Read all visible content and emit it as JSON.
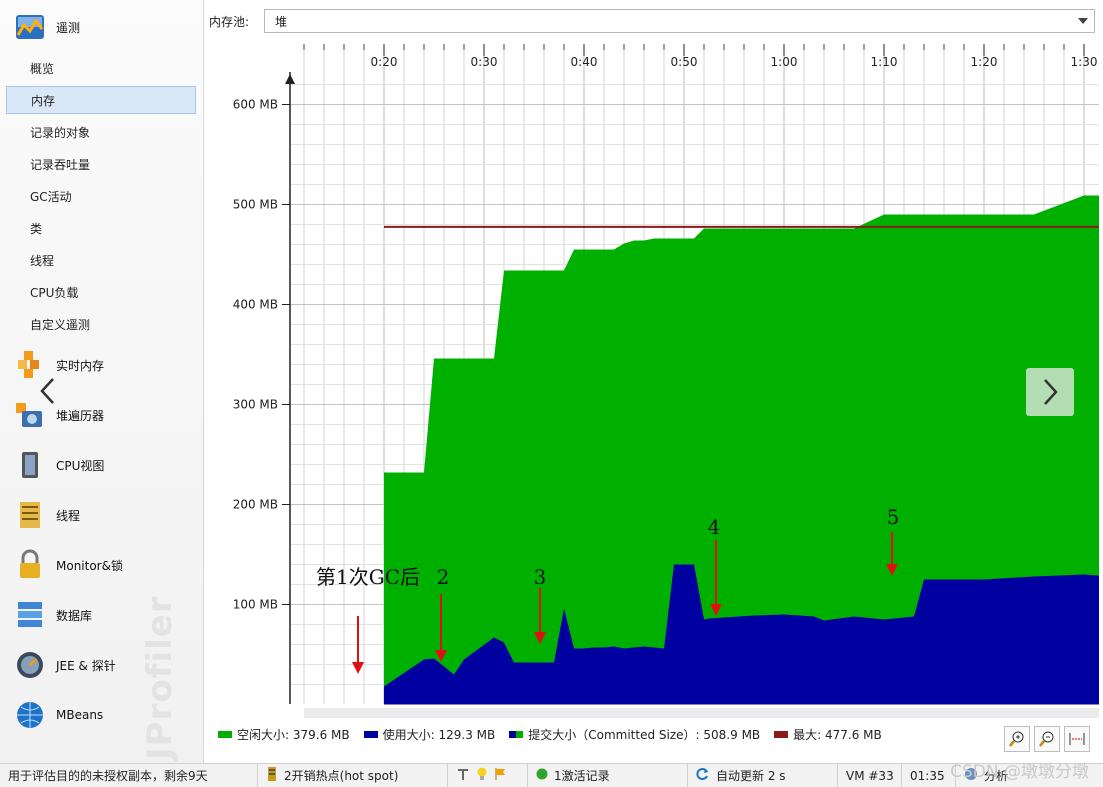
{
  "sidebar": {
    "sections_top": {
      "label": "遥测"
    },
    "sub_items": [
      "概览",
      "内存",
      "记录的对象",
      "记录吞吐量",
      "GC活动",
      "类",
      "线程",
      "CPU负载",
      "自定义遥测"
    ],
    "selected_index": 1,
    "sections": [
      "实时内存",
      "堆遍历器",
      "CPU视图",
      "线程",
      "Monitor&锁",
      "数据库",
      "JEE & 探针",
      "MBeans"
    ],
    "watermark": "JProfiler"
  },
  "pool": {
    "label": "内存池:",
    "value": "堆"
  },
  "legend": {
    "free": "空闲大小: 379.6 MB",
    "used": "使用大小: 129.3 MB",
    "committed": "提交大小（Committed Size）: 508.9 MB",
    "max": "最大: 477.6 MB"
  },
  "colors": {
    "free": "#00b000",
    "used": "#0000a0",
    "max": "#8b1a1a",
    "annotation": "#e01010"
  },
  "annotations": [
    "第1次GC后",
    "2",
    "3",
    "4",
    "5"
  ],
  "statusbar": {
    "license": "用于评估目的的未授权副本，剩余9天",
    "hotspots": "2开销热点(hot spot)",
    "recordings": "1激活记录",
    "auto_update": "自动更新 2 s",
    "vm": "VM #33",
    "time": "01:35",
    "analysis": "分析"
  },
  "watermark_csdn": "CSDN @墩墩分墩",
  "chart_data": {
    "type": "area",
    "x_ticks": [
      "0:20",
      "0:30",
      "0:40",
      "0:50",
      "1:00",
      "1:10",
      "1:20",
      "1:30"
    ],
    "y_ticks": [
      "100 MB",
      "200 MB",
      "300 MB",
      "400 MB",
      "500 MB",
      "600 MB"
    ],
    "ylim": [
      0,
      630
    ],
    "x_seconds": [
      10,
      14,
      15,
      17,
      18,
      21,
      22,
      23,
      25,
      26,
      27,
      28,
      29,
      30,
      31,
      32,
      33,
      34,
      35,
      36,
      37,
      38,
      39,
      41,
      42,
      42.5,
      44,
      47,
      50,
      53,
      54,
      57,
      60,
      63,
      64,
      70,
      75,
      80,
      84,
      85,
      88,
      91,
      94
    ],
    "series": [
      {
        "name": "提交大小（Committed Size）",
        "values": [
          232,
          232,
          346,
          346,
          346,
          346,
          434,
          434,
          434,
          434,
          434,
          434,
          455,
          455,
          455,
          455,
          455,
          461,
          464,
          464,
          466,
          466,
          466,
          466,
          476,
          476,
          476,
          476,
          476,
          476,
          476,
          476,
          490,
          490,
          490,
          490,
          490,
          509,
          509,
          509,
          509,
          509,
          509
        ]
      },
      {
        "name": "使用大小",
        "values": [
          18,
          45,
          46,
          30,
          45,
          67,
          62,
          42,
          42,
          42,
          42,
          96,
          56,
          56,
          57,
          57,
          58,
          56,
          57,
          58,
          57,
          56,
          140,
          140,
          85,
          86,
          87,
          89,
          90,
          88,
          84,
          88,
          85,
          88,
          125,
          125,
          128,
          130,
          127,
          128,
          126,
          128,
          129
        ]
      },
      {
        "name": "最大",
        "values": [
          477.6
        ]
      }
    ]
  }
}
